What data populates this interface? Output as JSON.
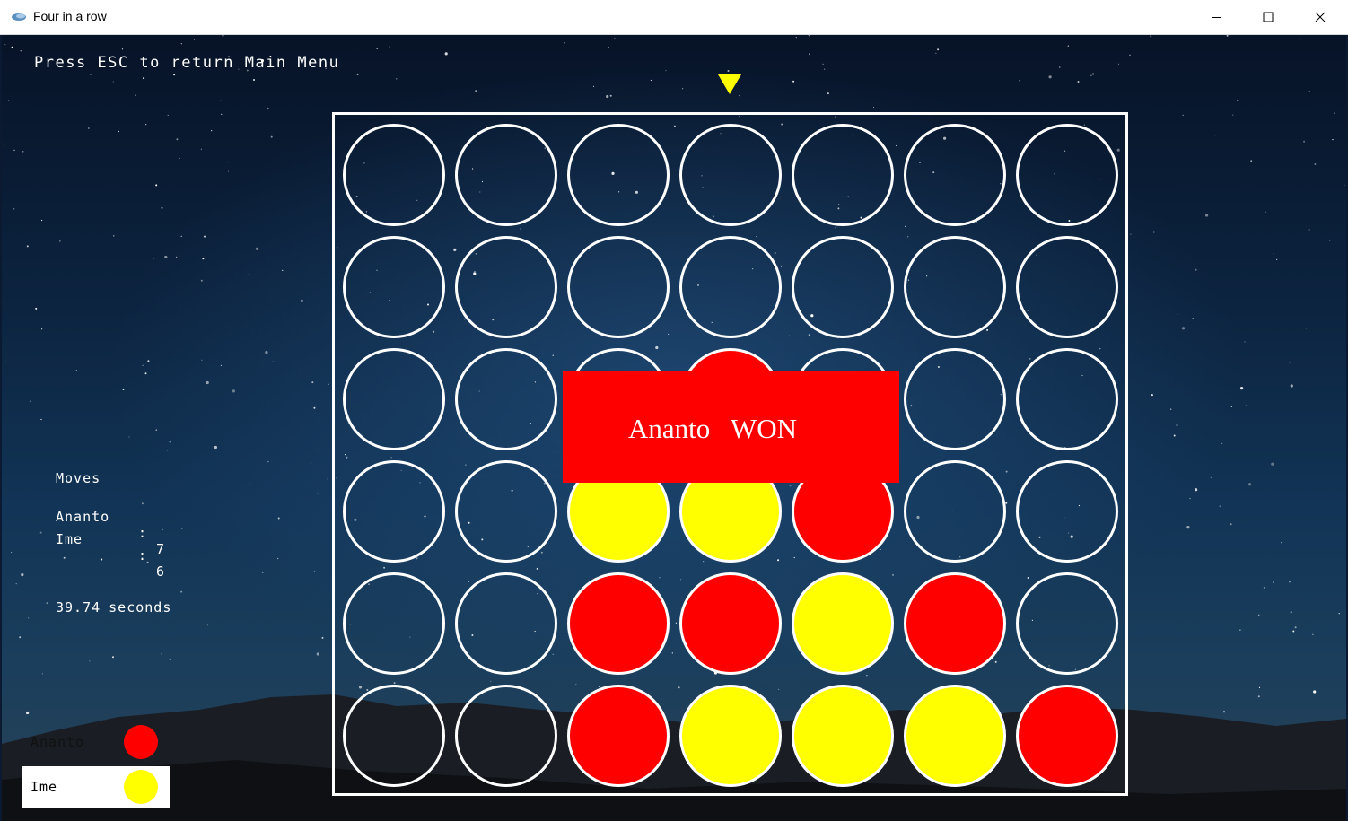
{
  "window": {
    "title": "Four in a row"
  },
  "hint": "Press ESC to return Main Menu",
  "board": {
    "columns": 7,
    "rows": 6,
    "drop_column": 4,
    "cells": [
      [
        "empty",
        "empty",
        "empty",
        "empty",
        "empty",
        "empty",
        "empty"
      ],
      [
        "empty",
        "empty",
        "empty",
        "empty",
        "empty",
        "empty",
        "empty"
      ],
      [
        "empty",
        "empty",
        "unknown",
        "red",
        "unknown",
        "empty",
        "empty"
      ],
      [
        "empty",
        "empty",
        "yellow",
        "yellow",
        "red",
        "empty",
        "empty"
      ],
      [
        "empty",
        "empty",
        "red",
        "red",
        "yellow",
        "red",
        "empty"
      ],
      [
        "empty",
        "empty",
        "red",
        "yellow",
        "yellow",
        "yellow",
        "red"
      ]
    ]
  },
  "result": {
    "winner": "Ananto",
    "text": "WON"
  },
  "stats": {
    "heading": "Moves",
    "players": [
      {
        "name": "Ananto",
        "colon": ":",
        "moves": "7"
      },
      {
        "name": "Ime",
        "colon": ":",
        "moves": "6"
      }
    ]
  },
  "timer": {
    "value": "39.74",
    "unit": "seconds"
  },
  "legend": [
    {
      "name": "Ananto",
      "color": "#ff0000",
      "active": false
    },
    {
      "name": "Ime",
      "color": "#ffff00",
      "active": true
    }
  ],
  "colors": {
    "red": "#ff0000",
    "yellow": "#ffff00",
    "board_line": "#ffffff"
  }
}
